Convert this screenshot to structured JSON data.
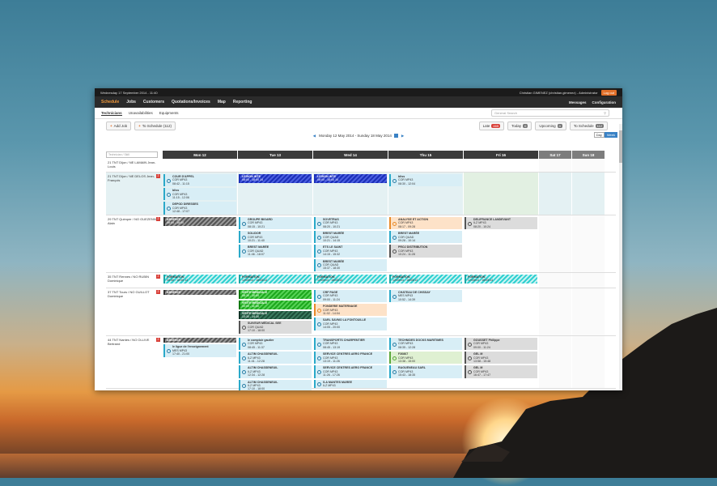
{
  "topbar": {
    "date": "Wednesday 17 September 2014 - 11:40",
    "user": "Christian GIMENEZ (christian.gimenez) - Administrator",
    "logout": "Log out"
  },
  "nav": {
    "items": [
      "Schedule",
      "Jobs",
      "Customers",
      "Quotations/Invoices",
      "Map",
      "Reporting"
    ],
    "right": [
      "Messages",
      "Configuration"
    ]
  },
  "subnav": {
    "tabs": [
      "Technicians",
      "Unavailabilities",
      "Equipments"
    ],
    "search_placeholder": "General Search"
  },
  "actions": {
    "add_job": "Add Job",
    "to_schedule": "To Schedule (112)",
    "late": "Late",
    "late_count": "465",
    "today": "Today",
    "today_count": "0",
    "upcoming": "Upcoming",
    "upcoming_count": "0",
    "to_schedule_right": "To Schedule",
    "to_schedule_count": "112"
  },
  "week": {
    "range": "Monday 12 May 2014 - Sunday 18 May 2014",
    "day_btn": "Day",
    "week_btn": "Week"
  },
  "grid": {
    "filter_placeholder": "Technician / Skill",
    "days": [
      "Mon 12",
      "Tue 13",
      "Wed 14",
      "Thu 15",
      "Fri 16"
    ],
    "weekend": [
      "Sat 17",
      "Sun 18"
    ]
  },
  "rows": [
    {
      "label": "21 TNT Dijon / NE LAMAIN Jean-Louis",
      "hl": false,
      "flag": "",
      "cells": [
        [],
        [],
        [],
        [],
        []
      ]
    },
    {
      "label": "21 TNT Dijon / NE DELOS Jean-François",
      "hl": true,
      "flag": "2",
      "cells": [
        [
          {
            "t": "COUR D'APPEL",
            "s": "COR MP43",
            "h": "08:42 - 11:15",
            "c": ""
          },
          {
            "t": "bliss",
            "s": "COR MP43",
            "h": "11:15 - 12:06",
            "c": ""
          },
          {
            "t": "DEPOD DIRESSES",
            "s": "COR MP43",
            "h": "12:48 - 17:07",
            "c": ""
          }
        ],
        [
          {
            "t": "LEGION INTE",
            "s": "",
            "h": "08:00 - 18:00 14",
            "c": "stripe-blue"
          }
        ],
        [
          {
            "t": "LEGION INTE",
            "s": "",
            "h": "08:00 - 18:00 14",
            "c": "stripe-blue"
          }
        ],
        [
          {
            "t": "bliss",
            "s": "COR MP43",
            "h": "08:30 - 12:04",
            "c": ""
          }
        ],
        []
      ]
    },
    {
      "label": "29 TNT Quimper / NO GUEZENNEC Alain",
      "hl": false,
      "flag": "2",
      "cells": [
        [
          {
            "t": "ABSENCE",
            "s": "",
            "h": "08:00 - 18:00",
            "c": "stripe-dark"
          }
        ],
        [
          {
            "t": "GROUPE BIGARD",
            "s": "COR MP43",
            "h": "08:15 - 10:21",
            "c": ""
          },
          {
            "t": "SOLIDOR",
            "s": "COR MP43",
            "h": "10:21 - 11:40",
            "c": ""
          },
          {
            "t": "BREST MARÉE",
            "s": "COR QUAD",
            "h": "11:46 - 18:07",
            "c": ""
          }
        ],
        [
          {
            "t": "SOVETRAS",
            "s": "COR MP43",
            "h": "08:20 - 10:21",
            "c": ""
          },
          {
            "t": "BREST MARÉE",
            "s": "COR QUAD",
            "h": "10:21 - 14:15",
            "c": ""
          },
          {
            "t": "ETS LE SAINT",
            "s": "COR MP43",
            "h": "14:15 - 15:32",
            "c": ""
          },
          {
            "t": "BREST MARÉE",
            "s": "COR QUAD",
            "h": "15:37 - 18:30",
            "c": ""
          }
        ],
        [
          {
            "t": "ANALYSE ET ACTION",
            "s": "COR MP43",
            "h": "08:17 - 09:28",
            "c": "orange"
          },
          {
            "t": "BREST MARÉE",
            "s": "COR QUAD",
            "h": "09:28 - 10:14",
            "c": ""
          },
          {
            "t": "PROJ DISTRIBUTION",
            "s": "COR MP43",
            "h": "10:24 - 11:28",
            "c": "grey"
          }
        ],
        [
          {
            "t": "DELIFRANCE LANDEVANT",
            "s": "ILZ MP43",
            "h": "08:20 - 10:24",
            "c": "grey"
          }
        ]
      ]
    },
    {
      "label": "35 TNT Rennes / NO RUBIN Dominique",
      "hl": false,
      "flag": "2",
      "cells": [
        [
          {
            "t": "FORMATION",
            "s": "",
            "h": "08:30 - 18:00 14",
            "c": "stripe-teal"
          }
        ],
        [
          {
            "t": "FORMATION",
            "s": "",
            "h": "12/05/14 - 16/05/14",
            "c": "stripe-teal"
          }
        ],
        [
          {
            "t": "FORMATION",
            "s": "",
            "h": "12/05/14 - 16/05/14",
            "c": "stripe-teal"
          }
        ],
        [
          {
            "t": "FORMATION",
            "s": "",
            "h": "12/05/14 - 16/05/14",
            "c": "stripe-teal"
          }
        ],
        [
          {
            "t": "FORMATION",
            "s": "",
            "h": "12/05/14 - 16/05/14",
            "c": "stripe-teal"
          }
        ]
      ]
    },
    {
      "label": "37 TNT Tours / NO GUILLOT Dominique",
      "hl": false,
      "flag": "2",
      "cells": [
        [
          {
            "t": "ABSENCE",
            "s": "",
            "h": "",
            "c": "stripe-dark"
          }
        ],
        [
          {
            "t": "VISITE MÉDICALE",
            "s": "",
            "h": "08:30 - 10:00",
            "c": "stripe-green"
          },
          {
            "t": "VISITE MÉDICALE",
            "s": "",
            "h": "10:00 - 11:30",
            "c": "stripe-green"
          },
          {
            "t": "VISITE MÉDICALE",
            "s": "",
            "h": "13:30 - 14:30",
            "c": "stripe-darkgreen"
          },
          {
            "t": "SUIVEUR MÉDICAL SEE",
            "s": "COR QUAD",
            "h": "17:10 - 18:00",
            "c": "grey"
          }
        ],
        [
          {
            "t": "CRF PAGE",
            "s": "COR MP43",
            "h": "09:00 - 11:24",
            "c": ""
          },
          {
            "t": "FONDERIE MATERNAGE",
            "s": "COR MP43",
            "h": "11:02 - 14:04",
            "c": "orange"
          },
          {
            "t": "SARL SAVMO LA FONTOUILLE",
            "s": "COR MP43",
            "h": "14:05 - 20:00",
            "c": ""
          }
        ],
        [
          {
            "t": "CHATEAU DE CHISSAY",
            "s": "MES MP43",
            "h": "10:52 - 14:39",
            "c": ""
          }
        ],
        []
      ]
    },
    {
      "label": "44 TNT Nantes / NO OLLIVE Bertrand",
      "hl": false,
      "flag": "2",
      "cells": [
        [
          {
            "t": "ABSENCE",
            "s": "",
            "h": "",
            "c": "stripe-dark"
          },
          {
            "t": "le ligue de l'enseignement",
            "s": "MES MP43",
            "h": "17:40 - 21:00",
            "c": ""
          }
        ],
        [
          {
            "t": "le comptoir gautier",
            "s": "COR MP43",
            "h": "08:45 - 11:37",
            "c": ""
          },
          {
            "t": "ALTIM CHASSENEUIL",
            "s": "ILZ MP43",
            "h": "11:41 - 12:28",
            "c": ""
          },
          {
            "t": "ALTIM CHASSENEUIL",
            "s": "ILZ MP43",
            "h": "12:34 - 12:28",
            "c": ""
          },
          {
            "t": "ALTIM CHASSENEUIL",
            "s": "ILZ MP43",
            "h": "17:10 - 18:00",
            "c": ""
          }
        ],
        [
          {
            "t": "TRANSPORTS CHARPENTIER",
            "s": "COR MP43",
            "h": "08:45 - 13:19",
            "c": ""
          },
          {
            "t": "SERVICE CENTRES AERO FRANCE",
            "s": "COR MP43",
            "h": "13:19 - 11:26",
            "c": ""
          },
          {
            "t": "SERVICE CENTRES AERO FRANCE",
            "s": "COR MP43",
            "h": "11:26 - 17:26",
            "c": ""
          },
          {
            "t": "S.A MANTES MAREE",
            "s": "ILZ MP43",
            "h": "",
            "c": ""
          }
        ],
        [
          {
            "t": "TECHNIDES DOCKS MARITIMES",
            "s": "COR MP43",
            "h": "08:35 - 12:28",
            "c": ""
          },
          {
            "t": "F30867",
            "s": "COR MP43",
            "h": "13:38 - 15:00",
            "c": "green"
          },
          {
            "t": "RAGUENEAU SARL",
            "s": "COR MP43",
            "h": "15:43 - 18:35",
            "c": ""
          }
        ],
        [
          {
            "t": "GOUSSET Philippe",
            "s": "COR MP43",
            "h": "09:00 - 11:24",
            "c": "grey"
          },
          {
            "t": "GEL M",
            "s": "COR MP43",
            "h": "13:58 - 15:48",
            "c": "grey"
          },
          {
            "t": "GEL M",
            "s": "COR MP43",
            "h": "16:47 - 17:47",
            "c": "grey"
          }
        ]
      ]
    }
  ]
}
